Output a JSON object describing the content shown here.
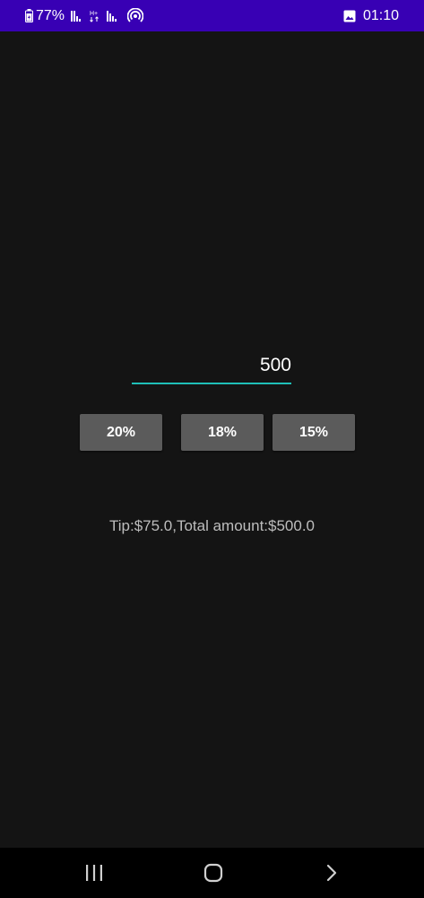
{
  "status_bar": {
    "battery_percent": "77%",
    "time": "01:10",
    "icons": [
      "battery-icon",
      "signal-icon",
      "data-arrows-icon",
      "signal-icon",
      "hotspot-icon",
      "gallery-notification-icon"
    ]
  },
  "main": {
    "amount_value": "500",
    "buttons": [
      {
        "label": "20%"
      },
      {
        "label": "18%"
      },
      {
        "label": "15%"
      }
    ],
    "result": "Tip:$75.0,Total amount:$500.0"
  },
  "nav_bar": {
    "icons": [
      "recent-apps-icon",
      "home-icon",
      "back-icon"
    ]
  },
  "colors": {
    "status_bar": "#3800b4",
    "background": "#141414",
    "accent": "#1fbfb8",
    "button": "#5b5b5b"
  }
}
